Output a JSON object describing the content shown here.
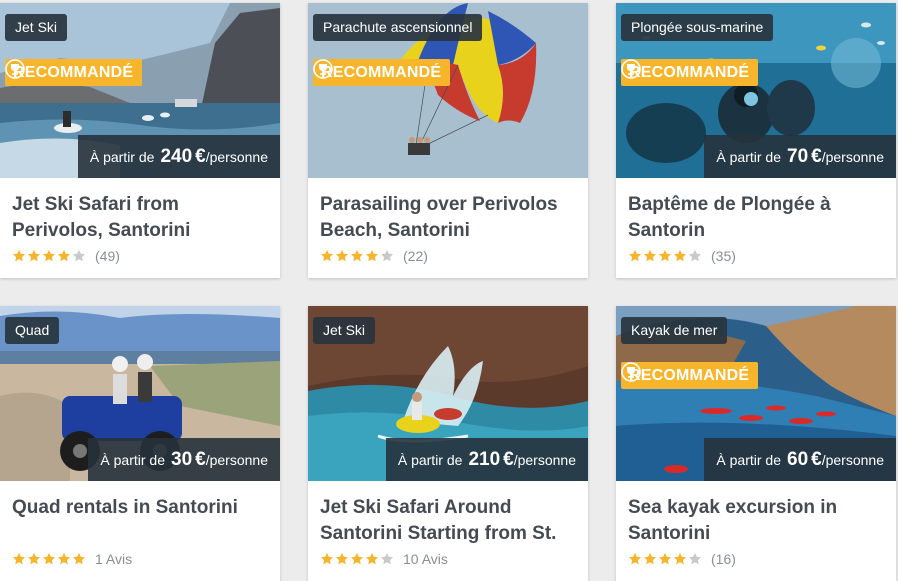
{
  "colors": {
    "accent": "#f7b52c",
    "overlay": "#26323c",
    "title": "#444b52"
  },
  "cards": [
    {
      "tag": "Jet Ski",
      "recommended": true,
      "reco_label": "RECOMMANDÉ",
      "price_prefix": "À partir de",
      "price": "240",
      "currency": "€",
      "price_suffix": "/personne",
      "title": "Jet Ski Safari from Perivolos, Santorini",
      "stars": 4,
      "reviews": "(49)"
    },
    {
      "tag": "Parachute ascensionnel",
      "recommended": true,
      "reco_label": "RECOMMANDÉ",
      "price_prefix": "",
      "price": "",
      "currency": "",
      "price_suffix": "",
      "title": "Parasailing over Perivolos Beach, Santorini",
      "stars": 4,
      "reviews": "(22)"
    },
    {
      "tag": "Plongée sous-marine",
      "recommended": true,
      "reco_label": "RECOMMANDÉ",
      "price_prefix": "À partir de",
      "price": "70",
      "currency": "€",
      "price_suffix": "/personne",
      "title": "Baptême de Plongée à Santorin",
      "stars": 4,
      "reviews": "(35)"
    },
    {
      "tag": "Quad",
      "recommended": false,
      "reco_label": "",
      "price_prefix": "À partir de",
      "price": "30",
      "currency": "€",
      "price_suffix": "/personne",
      "title": "Quad rentals in Santorini",
      "stars": 5,
      "reviews": "1 Avis"
    },
    {
      "tag": "Jet Ski",
      "recommended": false,
      "reco_label": "",
      "price_prefix": "À partir de",
      "price": "210",
      "currency": "€",
      "price_suffix": "/personne",
      "title": "Jet Ski Safari Around Santorini Starting from St.",
      "stars": 4,
      "reviews": "10 Avis"
    },
    {
      "tag": "Kayak de mer",
      "recommended": true,
      "reco_label": "RECOMMANDÉ",
      "price_prefix": "À partir de",
      "price": "60",
      "currency": "€",
      "price_suffix": "/personne",
      "title": "Sea kayak excursion in Santorini",
      "stars": 4,
      "reviews": "(16)"
    }
  ]
}
